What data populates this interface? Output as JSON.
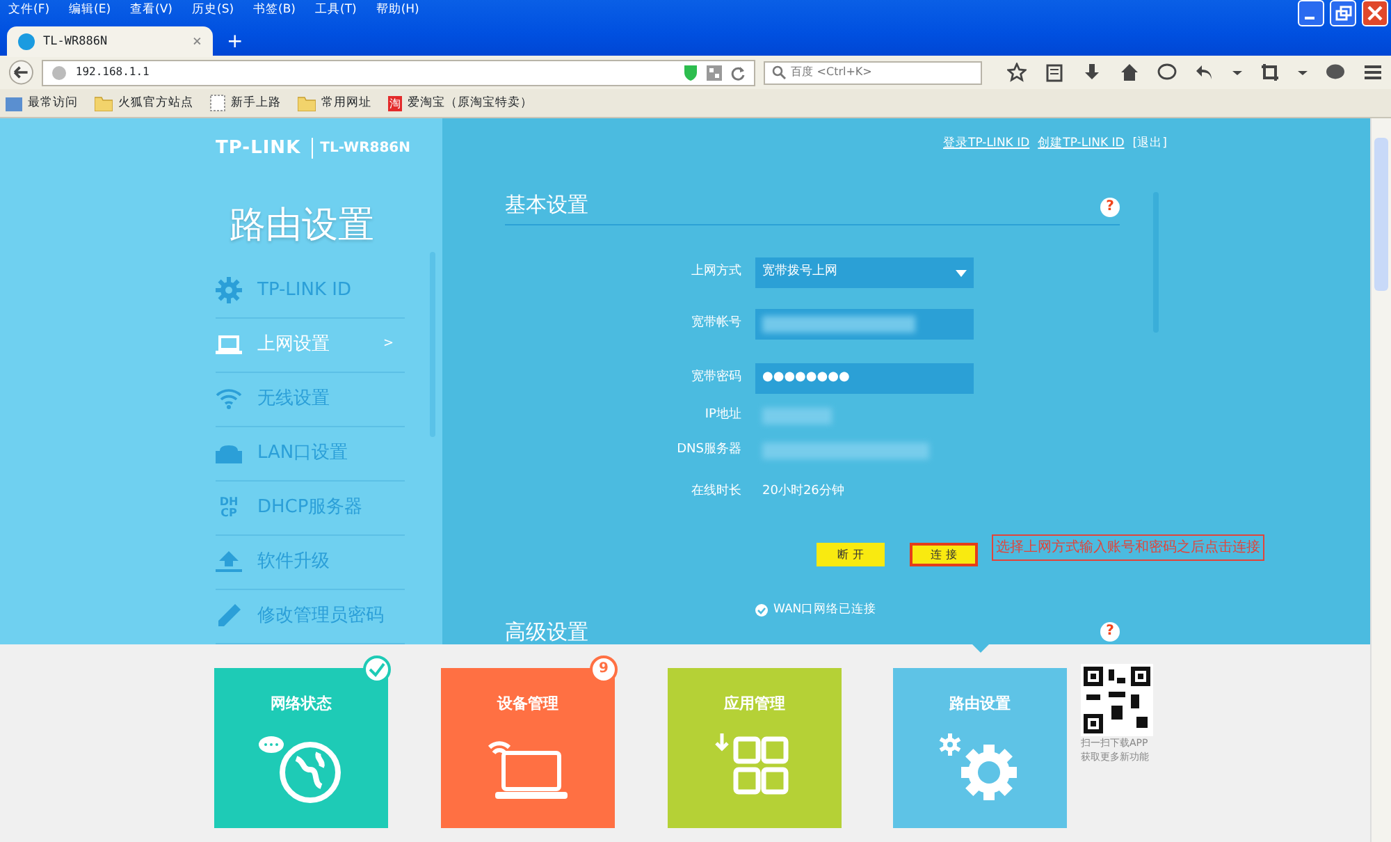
{
  "browser": {
    "menu": [
      "文件(F)",
      "编辑(E)",
      "查看(V)",
      "历史(S)",
      "书签(B)",
      "工具(T)",
      "帮助(H)"
    ],
    "tab": {
      "title": "TL-WR886N",
      "close": "×"
    },
    "new_tab": "+",
    "address": "192.168.1.1",
    "search": {
      "placeholder": "百度 <Ctrl+K>"
    },
    "bookmarks": [
      {
        "kind": "smart",
        "label": "最常访问"
      },
      {
        "kind": "folder",
        "label": "火狐官方站点"
      },
      {
        "kind": "page",
        "label": "新手上路"
      },
      {
        "kind": "folder",
        "label": "常用网址"
      },
      {
        "kind": "taobao",
        "icon_text": "淘",
        "label": "爱淘宝（原淘宝特卖）"
      }
    ]
  },
  "router": {
    "brand": "TP-LINK",
    "model": "TL-WR886N",
    "top_links": [
      {
        "label": "登录TP-LINK ID",
        "kind": "link"
      },
      {
        "label": "创建TP-LINK ID",
        "kind": "link"
      },
      {
        "label": "[退出]",
        "kind": "plain"
      }
    ],
    "sidebar": {
      "title": "路由设置",
      "items": [
        {
          "label": "TP-LINK ID",
          "selected": false
        },
        {
          "label": "上网设置",
          "selected": true,
          "arrow": ">"
        },
        {
          "label": "无线设置",
          "selected": false
        },
        {
          "label": "LAN口设置",
          "selected": false
        },
        {
          "icon_text": [
            "DH",
            "CP"
          ],
          "label": "DHCP服务器",
          "selected": false
        },
        {
          "label": "软件升级",
          "selected": false
        },
        {
          "label": "修改管理员密码",
          "selected": false
        }
      ]
    },
    "basic": {
      "title": "基本设置",
      "help": "?",
      "fields": [
        {
          "kind": "select",
          "label": "上网方式",
          "value": "宽带拨号上网"
        },
        {
          "kind": "input",
          "label": "宽带帐号"
        },
        {
          "kind": "input",
          "label": "宽带密码",
          "value": "●●●●●●●●"
        },
        {
          "kind": "text",
          "label": "IP地址"
        },
        {
          "kind": "text",
          "label": "DNS服务器"
        },
        {
          "kind": "text",
          "label": "在线时长",
          "value": "20小时26分钟"
        }
      ],
      "buttons": [
        {
          "label": "断 开",
          "highlighted": false
        },
        {
          "label": "连 接",
          "highlighted": true
        }
      ],
      "annotation": "选择上网方式输入账号和密码之后点击连接",
      "status": {
        "label": "WAN口网络已连接"
      }
    },
    "advanced": {
      "title": "高级设置",
      "help": "?"
    },
    "tiles": [
      {
        "label": "网络状态",
        "color": "#1ecbb6",
        "checked": true,
        "selected": false
      },
      {
        "label": "设备管理",
        "color": "#ff7043",
        "checked": false,
        "badge": "9",
        "selected": false
      },
      {
        "label": "应用管理",
        "color": "#b5d136",
        "checked": false,
        "selected": false
      },
      {
        "label": "路由设置",
        "color": "#5ec3e6",
        "checked": false,
        "selected": true
      }
    ],
    "qr_caption": [
      "扫一扫下载APP",
      "获取更多新功能"
    ]
  }
}
